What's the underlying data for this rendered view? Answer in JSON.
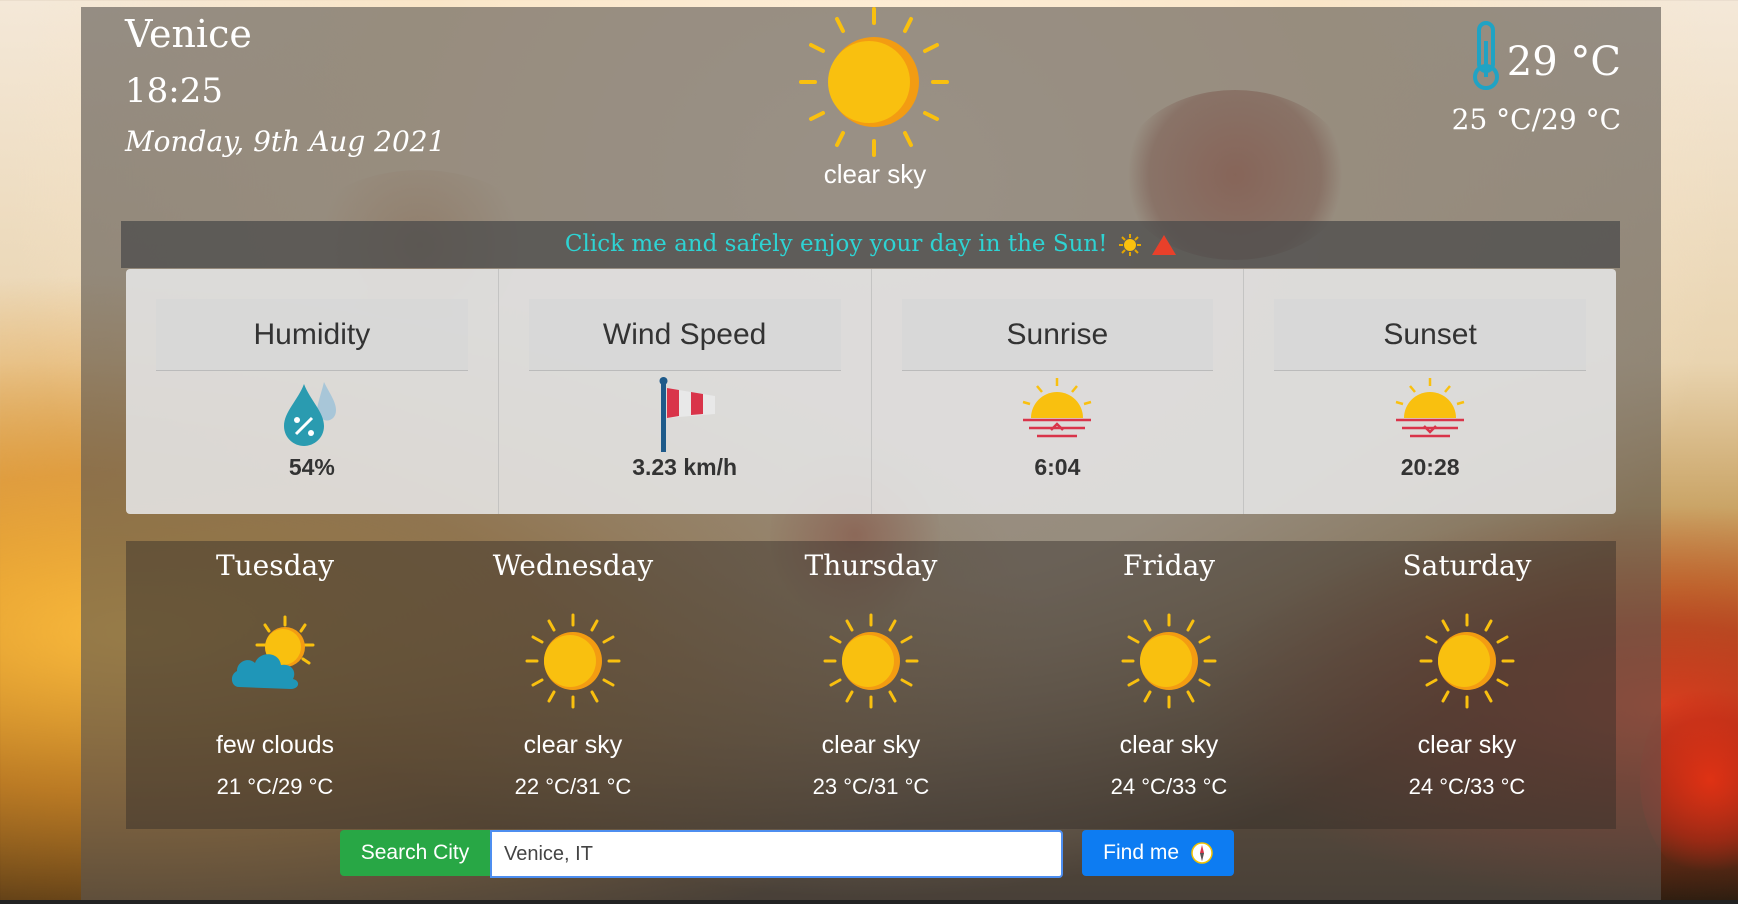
{
  "current": {
    "city": "Venice",
    "time": "18:25",
    "date": "Monday, 9th Aug 2021",
    "description": "clear sky",
    "icon": "sun-icon",
    "temp": "29 °C",
    "range": "25 °C/29 °C"
  },
  "banner": {
    "text": "Click me and safely enjoy your day in the Sun!"
  },
  "stats": [
    {
      "label": "Humidity",
      "value": "54%",
      "icon": "humidity-drop-icon"
    },
    {
      "label": "Wind Speed",
      "value": "3.23 km/h",
      "icon": "windsock-icon"
    },
    {
      "label": "Sunrise",
      "value": "6:04",
      "icon": "sunrise-icon"
    },
    {
      "label": "Sunset",
      "value": "20:28",
      "icon": "sunset-icon"
    }
  ],
  "forecast": [
    {
      "day": "Tuesday",
      "description": "few clouds",
      "range": "21 °C/29 °C",
      "icon": "sun-cloud-icon"
    },
    {
      "day": "Wednesday",
      "description": "clear sky",
      "range": "22 °C/31 °C",
      "icon": "sun-icon"
    },
    {
      "day": "Thursday",
      "description": "clear sky",
      "range": "23 °C/31 °C",
      "icon": "sun-icon"
    },
    {
      "day": "Friday",
      "description": "clear sky",
      "range": "24 °C/33 °C",
      "icon": "sun-icon"
    },
    {
      "day": "Saturday",
      "description": "clear sky",
      "range": "24 °C/33 °C",
      "icon": "sun-icon"
    }
  ],
  "search": {
    "button_label": "Search City",
    "input_value": "Venice, IT",
    "find_label": "Find me"
  },
  "colors": {
    "search_green": "#28a745",
    "find_blue": "#0d7cf2",
    "banner_text": "#2ed3d3",
    "sun_yellow": "#f9c00f"
  }
}
